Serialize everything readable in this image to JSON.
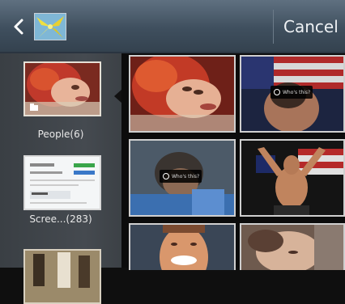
{
  "header": {
    "back_icon": "chevron-left-icon",
    "app_icon": "gallery-thumbnail",
    "cancel_label": "Cancel"
  },
  "sidebar": {
    "albums": [
      {
        "label": "People(6)",
        "selected": true
      },
      {
        "label": "Scree...(283)",
        "selected": false
      },
      {
        "label": "",
        "selected": false
      }
    ]
  },
  "grid": {
    "photos": [
      {
        "subject": "red-haired woman lying down",
        "tag_label": ""
      },
      {
        "subject": "man with flag, face tag",
        "tag_label": "Who's this?"
      },
      {
        "subject": "person looking down, face tag",
        "tag_label": "Who's this?"
      },
      {
        "subject": "shirtless athlete with flag",
        "tag_label": ""
      },
      {
        "subject": "smiling man",
        "tag_label": ""
      },
      {
        "subject": "man resting head",
        "tag_label": ""
      }
    ]
  },
  "colors": {
    "topbar": "#3f4f5e",
    "sidebar": "#454a50",
    "grid_bg": "#0c0c0c",
    "photo_border": "#cfcfcf"
  }
}
